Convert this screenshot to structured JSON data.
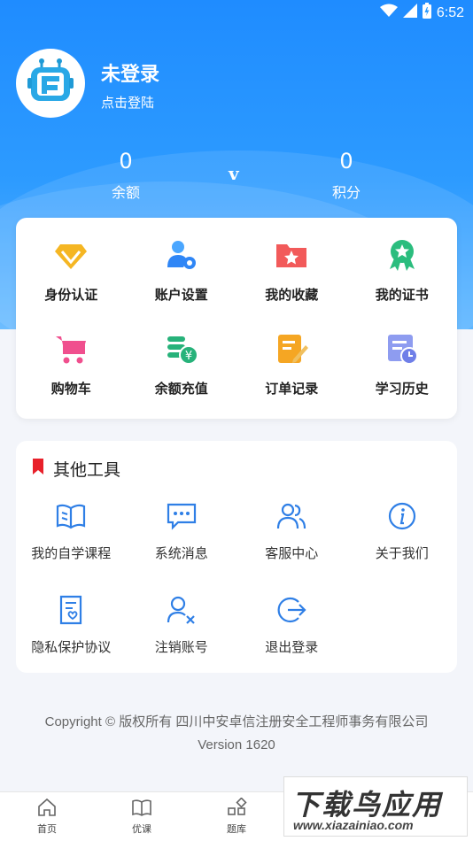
{
  "status_bar": {
    "time": "6:52",
    "battery_icon": "battery-icon",
    "signal_icon": "signal-icon",
    "wifi_icon": "wifi-icon"
  },
  "profile": {
    "name": "未登录",
    "login_hint": "点击登陆",
    "avatar_icon": "robot-avatar-icon"
  },
  "stats": {
    "balance": {
      "value": "0",
      "label": "余额"
    },
    "vip_mark": "v",
    "points": {
      "value": "0",
      "label": "积分"
    }
  },
  "quick_menu": [
    {
      "label": "身份认证",
      "icon": "diamond-icon",
      "color": "#f5b623"
    },
    {
      "label": "账户设置",
      "icon": "user-gear-icon",
      "color": "#2f86f6"
    },
    {
      "label": "我的收藏",
      "icon": "star-folder-icon",
      "color": "#f25a5a"
    },
    {
      "label": "我的证书",
      "icon": "medal-icon",
      "color": "#2bbd7e"
    },
    {
      "label": "购物车",
      "icon": "cart-icon",
      "color": "#f04f8e"
    },
    {
      "label": "余额充值",
      "icon": "coin-stack-icon",
      "color": "#27b27a"
    },
    {
      "label": "订单记录",
      "icon": "order-note-icon",
      "color": "#f5a623"
    },
    {
      "label": "学习历史",
      "icon": "history-icon",
      "color": "#6f7fe8"
    }
  ],
  "tools": {
    "title": "其他工具",
    "items": [
      {
        "label": "我的自学课程",
        "icon": "book-icon"
      },
      {
        "label": "系统消息",
        "icon": "message-icon"
      },
      {
        "label": "客服中心",
        "icon": "users-icon"
      },
      {
        "label": "关于我们",
        "icon": "info-icon"
      },
      {
        "label": "隐私保护协议",
        "icon": "privacy-doc-icon"
      },
      {
        "label": "注销账号",
        "icon": "user-remove-icon"
      },
      {
        "label": "退出登录",
        "icon": "logout-icon"
      }
    ]
  },
  "footer": {
    "copyright": "Copyright © 版权所有 四川中安卓信注册安全工程师事务有限公司",
    "version": "Version 1620"
  },
  "tabbar": [
    {
      "label": "首页",
      "icon": "home-icon"
    },
    {
      "label": "优课",
      "icon": "open-book-icon"
    },
    {
      "label": "题库",
      "icon": "grid-icon"
    }
  ],
  "watermark": {
    "title": "下载鸟应用",
    "url": "www.xiazainiao.com"
  },
  "colors": {
    "primary": "#1f8cff",
    "accent_blue": "#2f7fe6",
    "bookmark_red": "#e8202a"
  }
}
